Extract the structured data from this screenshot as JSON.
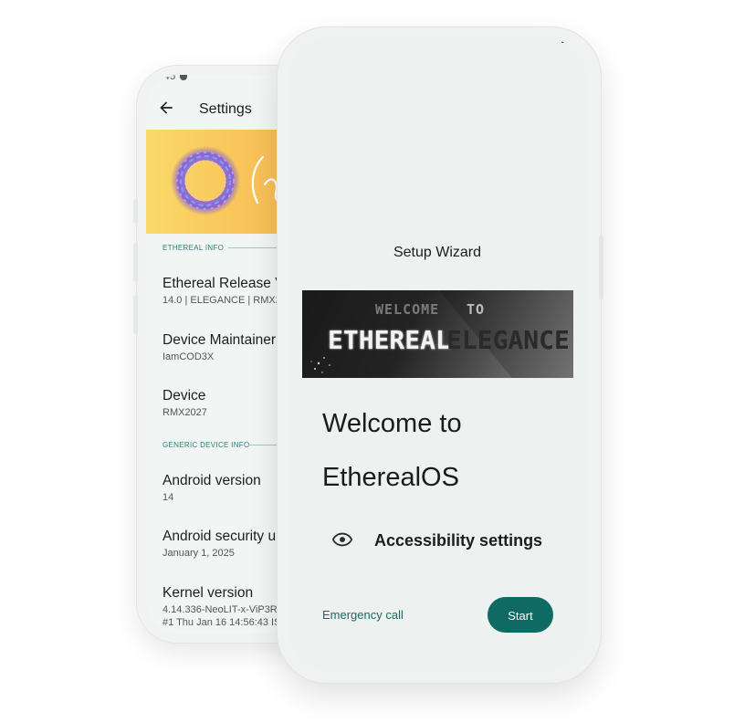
{
  "back_phone": {
    "status_time": ":45",
    "toolbar": {
      "title": "Settings"
    },
    "sections": [
      {
        "header": "ETHEREAL INFO",
        "items": [
          {
            "title": "Ethereal Release V",
            "summary": "14.0 | ELEGANCE | RMX20"
          },
          {
            "title": "Device Maintainer",
            "summary": "IamCOD3X"
          },
          {
            "title": "Device",
            "summary": "RMX2027"
          }
        ]
      },
      {
        "header": "GENERIC DEVICE INFO",
        "items": [
          {
            "title": "Android version",
            "summary": "14"
          },
          {
            "title": "Android security u",
            "summary": "January 1, 2025"
          },
          {
            "title": "Kernel version",
            "summary": "4.14.336-NeoLIT-x-ViP3R",
            "summary2": "#1 Thu Jan 16 14:56:43 IS"
          }
        ]
      }
    ],
    "banner": {
      "colors": [
        "#fbd96a",
        "#f6b04f"
      ],
      "ring_color": "#8f5fd6"
    }
  },
  "front_phone": {
    "title": "Setup Wizard",
    "hero": {
      "line1_left": "WELCOME",
      "line1_right": "TO",
      "line2_left": "ETHEREAL",
      "line2_right": "ELEGANCE"
    },
    "heading_line1": "Welcome to",
    "heading_line2": "EtherealOS",
    "accessibility": {
      "icon": "eye-icon",
      "label": "Accessibility settings"
    },
    "emergency_label": "Emergency call",
    "start_label": "Start",
    "accent": "#0e6a62"
  }
}
